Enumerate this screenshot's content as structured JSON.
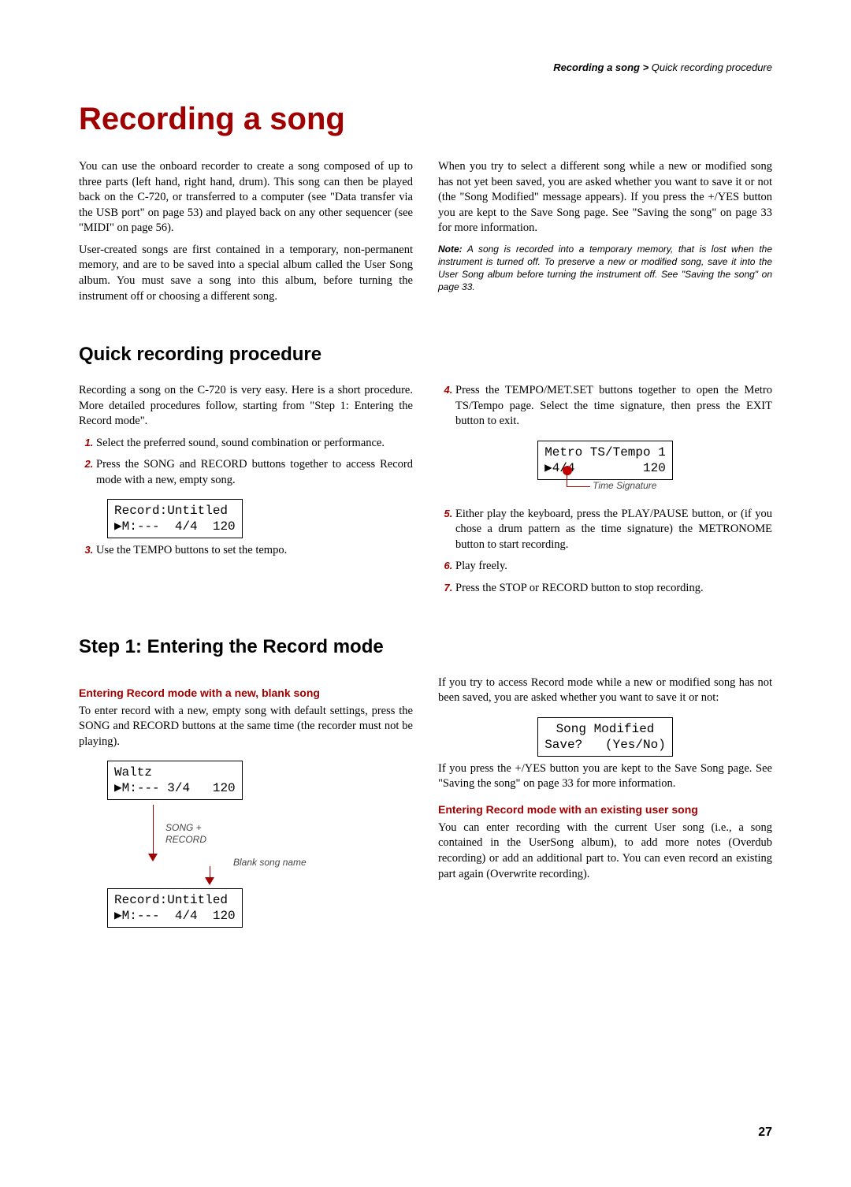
{
  "header": {
    "bold": "Recording a song > ",
    "rest": "Quick recording procedure"
  },
  "chapter_title": "Recording a song",
  "intro": {
    "left_p1": "You can use the onboard recorder to create a song composed of up to three parts (left hand, right hand, drum). This song can then be played back on the C-720, or transferred to a computer (see \"Data transfer via the USB port\" on page 53) and played back on any other sequencer (see \"MIDI\" on page 56).",
    "left_p2": "User-created songs are first contained in a temporary, non-permanent memory, and are to be saved into a special album called the User Song album. You must save a song into this album, before turning the instrument off or choosing a different song.",
    "right_p1": "When you try to select a different song while a new or modified song has not yet been saved, you are asked whether you want to save it or not (the \"Song Modified\" message appears). If you press the +/YES button you are kept to the Save Song page. See \"Saving the song\" on page 33 for more information.",
    "note_label": "Note:",
    "note_text": " A song is recorded into a temporary memory, that is lost when the instrument is turned off. To preserve a new or modified song, save it into the User Song album before turning the instrument off. See \"Saving the song\" on page 33."
  },
  "quick": {
    "title": "Quick recording procedure",
    "left_p": "Recording a song on the C-720 is very easy. Here is a short procedure. More detailed procedures follow, starting from \"Step 1: Entering the Record mode\".",
    "steps_left": [
      "Select the preferred sound, sound combination or performance.",
      "Press the SONG and RECORD buttons together to access Record mode with a new, empty song.",
      "Use the TEMPO buttons to set the tempo."
    ],
    "lcd_record": "Record:Untitled\n▶M:---  4/4  120",
    "steps_right_4": "Press the TEMPO/MET.SET buttons together to open the Metro TS/Tempo page. Select the time signature, then press the EXIT button to exit.",
    "lcd_metro": "Metro TS/Tempo 1\n▶4/4         120",
    "ts_caption": "Time Signature",
    "steps_right_5": "Either play the keyboard, press the PLAY/PAUSE button, or (if you chose a drum pattern as the time signature) the METRONOME button to start recording.",
    "steps_right_6": "Play freely.",
    "steps_right_7": "Press the STOP or RECORD button to stop recording."
  },
  "step1": {
    "title": "Step 1: Entering the Record mode",
    "sub1": "Entering Record mode with a new, blank song",
    "p1": "To enter record with a new, empty song with default settings, press the SONG and RECORD buttons at the same time (the recorder must not be playing).",
    "lcd_waltz": "Waltz\n▶M:--- 3/4   120",
    "arrow_label": "SONG +\nRECORD",
    "blank_label": "Blank song name",
    "lcd_record2": "Record:Untitled\n▶M:---  4/4  120",
    "right_p1": "If you try to access Record mode while a new or modified song has not been saved, you are asked whether you want to save it or not:",
    "lcd_modified": "Song Modified\nSave?   (Yes/No)",
    "right_p2": "If you press the +/YES button you are kept to the Save Song page. See \"Saving the song\" on page 33 for more information.",
    "sub2": "Entering Record mode with an existing user song",
    "right_p3": "You can enter recording with the current User song (i.e., a song contained in the UserSong album), to add more notes (Overdub recording) or add an additional part to. You can even record an existing part again (Overwrite recording)."
  },
  "page_number": "27"
}
